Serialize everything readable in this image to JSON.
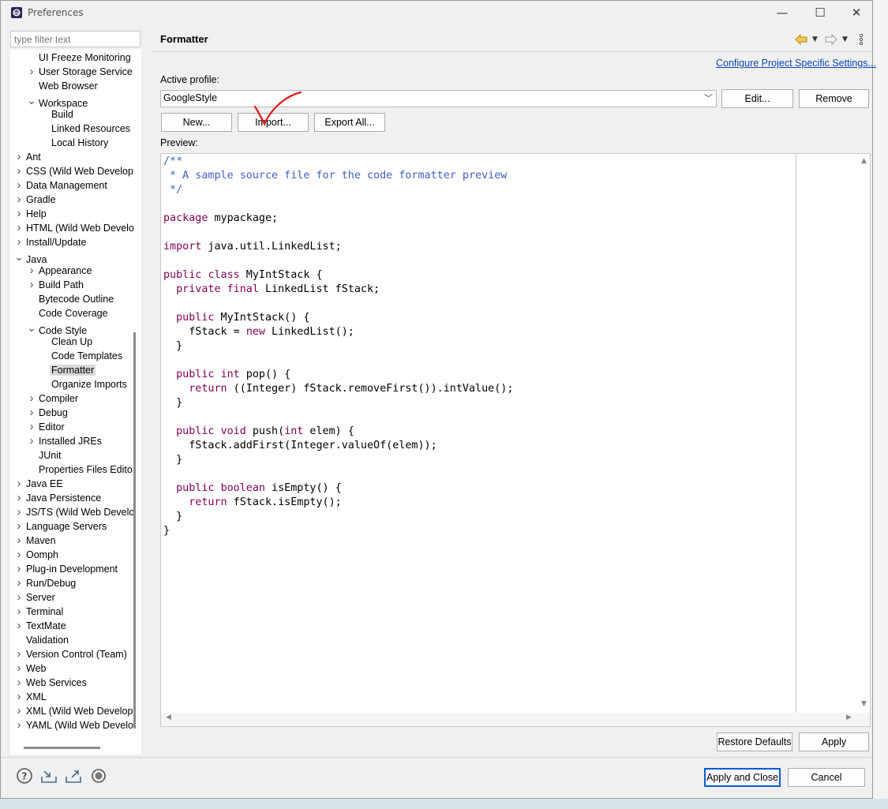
{
  "window": {
    "title": "Preferences",
    "controls": {
      "minimize": "—",
      "maximize": "☐",
      "close": "✕"
    }
  },
  "filter": {
    "placeholder": "type filter text"
  },
  "tree": [
    {
      "label": "UI Freeze Monitoring",
      "level": 2,
      "expand": "none"
    },
    {
      "label": "User Storage Service",
      "level": 2,
      "expand": "collapsed"
    },
    {
      "label": "Web Browser",
      "level": 2,
      "expand": "none"
    },
    {
      "label": "Workspace",
      "level": 2,
      "expand": "expanded"
    },
    {
      "label": "Build",
      "level": 3,
      "expand": "none"
    },
    {
      "label": "Linked Resources",
      "level": 3,
      "expand": "none"
    },
    {
      "label": "Local History",
      "level": 3,
      "expand": "none"
    },
    {
      "label": "Ant",
      "level": 1,
      "expand": "collapsed"
    },
    {
      "label": "CSS (Wild Web Develop",
      "level": 1,
      "expand": "collapsed"
    },
    {
      "label": "Data Management",
      "level": 1,
      "expand": "collapsed"
    },
    {
      "label": "Gradle",
      "level": 1,
      "expand": "collapsed"
    },
    {
      "label": "Help",
      "level": 1,
      "expand": "collapsed"
    },
    {
      "label": "HTML (Wild Web Develo",
      "level": 1,
      "expand": "collapsed"
    },
    {
      "label": "Install/Update",
      "level": 1,
      "expand": "collapsed"
    },
    {
      "label": "Java",
      "level": 1,
      "expand": "expanded"
    },
    {
      "label": "Appearance",
      "level": 2,
      "expand": "collapsed"
    },
    {
      "label": "Build Path",
      "level": 2,
      "expand": "collapsed"
    },
    {
      "label": "Bytecode Outline",
      "level": 2,
      "expand": "none"
    },
    {
      "label": "Code Coverage",
      "level": 2,
      "expand": "none"
    },
    {
      "label": "Code Style",
      "level": 2,
      "expand": "expanded"
    },
    {
      "label": "Clean Up",
      "level": 3,
      "expand": "none"
    },
    {
      "label": "Code Templates",
      "level": 3,
      "expand": "none"
    },
    {
      "label": "Formatter",
      "level": 3,
      "expand": "none",
      "selected": true
    },
    {
      "label": "Organize Imports",
      "level": 3,
      "expand": "none"
    },
    {
      "label": "Compiler",
      "level": 2,
      "expand": "collapsed"
    },
    {
      "label": "Debug",
      "level": 2,
      "expand": "collapsed"
    },
    {
      "label": "Editor",
      "level": 2,
      "expand": "collapsed"
    },
    {
      "label": "Installed JREs",
      "level": 2,
      "expand": "collapsed"
    },
    {
      "label": "JUnit",
      "level": 2,
      "expand": "none"
    },
    {
      "label": "Properties Files Edito",
      "level": 2,
      "expand": "none"
    },
    {
      "label": "Java EE",
      "level": 1,
      "expand": "collapsed"
    },
    {
      "label": "Java Persistence",
      "level": 1,
      "expand": "collapsed"
    },
    {
      "label": "JS/TS (Wild Web Develc",
      "level": 1,
      "expand": "collapsed"
    },
    {
      "label": "Language Servers",
      "level": 1,
      "expand": "collapsed"
    },
    {
      "label": "Maven",
      "level": 1,
      "expand": "collapsed"
    },
    {
      "label": "Oomph",
      "level": 1,
      "expand": "collapsed"
    },
    {
      "label": "Plug-in Development",
      "level": 1,
      "expand": "collapsed"
    },
    {
      "label": "Run/Debug",
      "level": 1,
      "expand": "collapsed"
    },
    {
      "label": "Server",
      "level": 1,
      "expand": "collapsed"
    },
    {
      "label": "Terminal",
      "level": 1,
      "expand": "collapsed"
    },
    {
      "label": "TextMate",
      "level": 1,
      "expand": "collapsed"
    },
    {
      "label": "Validation",
      "level": 1,
      "expand": "none"
    },
    {
      "label": "Version Control (Team)",
      "level": 1,
      "expand": "collapsed"
    },
    {
      "label": "Web",
      "level": 1,
      "expand": "collapsed"
    },
    {
      "label": "Web Services",
      "level": 1,
      "expand": "collapsed"
    },
    {
      "label": "XML",
      "level": 1,
      "expand": "collapsed"
    },
    {
      "label": "XML (Wild Web Develop",
      "level": 1,
      "expand": "collapsed"
    },
    {
      "label": "YAML (Wild Web Develo",
      "level": 1,
      "expand": "collapsed"
    }
  ],
  "panel": {
    "title": "Formatter",
    "config_link": "Configure Project Specific Settings...",
    "active_profile_label": "Active profile:",
    "active_profile_value": "GoogleStyle",
    "buttons": {
      "edit": "Edit...",
      "remove": "Remove",
      "new": "New...",
      "import": "Import...",
      "export_all": "Export All..."
    },
    "preview_label": "Preview:"
  },
  "code_lines": [
    [
      [
        "c",
        "/**"
      ]
    ],
    [
      [
        "c",
        " * A sample source file for the code formatter preview"
      ]
    ],
    [
      [
        "c",
        " */"
      ]
    ],
    [],
    [
      [
        "k",
        "package"
      ],
      [
        "t",
        " mypackage;"
      ]
    ],
    [],
    [
      [
        "k",
        "import"
      ],
      [
        "t",
        " java.util.LinkedList;"
      ]
    ],
    [],
    [
      [
        "k",
        "public"
      ],
      [
        "t",
        " "
      ],
      [
        "k",
        "class"
      ],
      [
        "t",
        " MyIntStack {"
      ]
    ],
    [
      [
        "t",
        "  "
      ],
      [
        "k",
        "private"
      ],
      [
        "t",
        " "
      ],
      [
        "k",
        "final"
      ],
      [
        "t",
        " LinkedList fStack;"
      ]
    ],
    [],
    [
      [
        "t",
        "  "
      ],
      [
        "k",
        "public"
      ],
      [
        "t",
        " MyIntStack() {"
      ]
    ],
    [
      [
        "t",
        "    fStack = "
      ],
      [
        "k",
        "new"
      ],
      [
        "t",
        " LinkedList();"
      ]
    ],
    [
      [
        "t",
        "  }"
      ]
    ],
    [],
    [
      [
        "t",
        "  "
      ],
      [
        "k",
        "public"
      ],
      [
        "t",
        " "
      ],
      [
        "k",
        "int"
      ],
      [
        "t",
        " pop() {"
      ]
    ],
    [
      [
        "t",
        "    "
      ],
      [
        "k",
        "return"
      ],
      [
        "t",
        " ((Integer) fStack.removeFirst()).intValue();"
      ]
    ],
    [
      [
        "t",
        "  }"
      ]
    ],
    [],
    [
      [
        "t",
        "  "
      ],
      [
        "k",
        "public"
      ],
      [
        "t",
        " "
      ],
      [
        "k",
        "void"
      ],
      [
        "t",
        " push("
      ],
      [
        "k",
        "int"
      ],
      [
        "t",
        " elem) {"
      ]
    ],
    [
      [
        "t",
        "    fStack.addFirst(Integer.valueOf(elem));"
      ]
    ],
    [
      [
        "t",
        "  }"
      ]
    ],
    [],
    [
      [
        "t",
        "  "
      ],
      [
        "k",
        "public"
      ],
      [
        "t",
        " "
      ],
      [
        "k",
        "boolean"
      ],
      [
        "t",
        " isEmpty() {"
      ]
    ],
    [
      [
        "t",
        "    "
      ],
      [
        "k",
        "return"
      ],
      [
        "t",
        " fStack.isEmpty();"
      ]
    ],
    [
      [
        "t",
        "  }"
      ]
    ],
    [
      [
        "t",
        "}"
      ]
    ]
  ],
  "footer": {
    "restore_defaults": "Restore Defaults",
    "apply": "Apply",
    "apply_and_close": "Apply and Close",
    "cancel": "Cancel"
  },
  "colors": {
    "comment": "#3f5fbf",
    "keyword": "#7f0055",
    "link": "#0a46b4",
    "checkmark": "#e01818"
  },
  "icons": [
    "help-icon",
    "import-prefs-icon",
    "export-prefs-icon",
    "record-icon",
    "back-arrow-icon",
    "forward-arrow-icon",
    "view-menu-icon"
  ]
}
